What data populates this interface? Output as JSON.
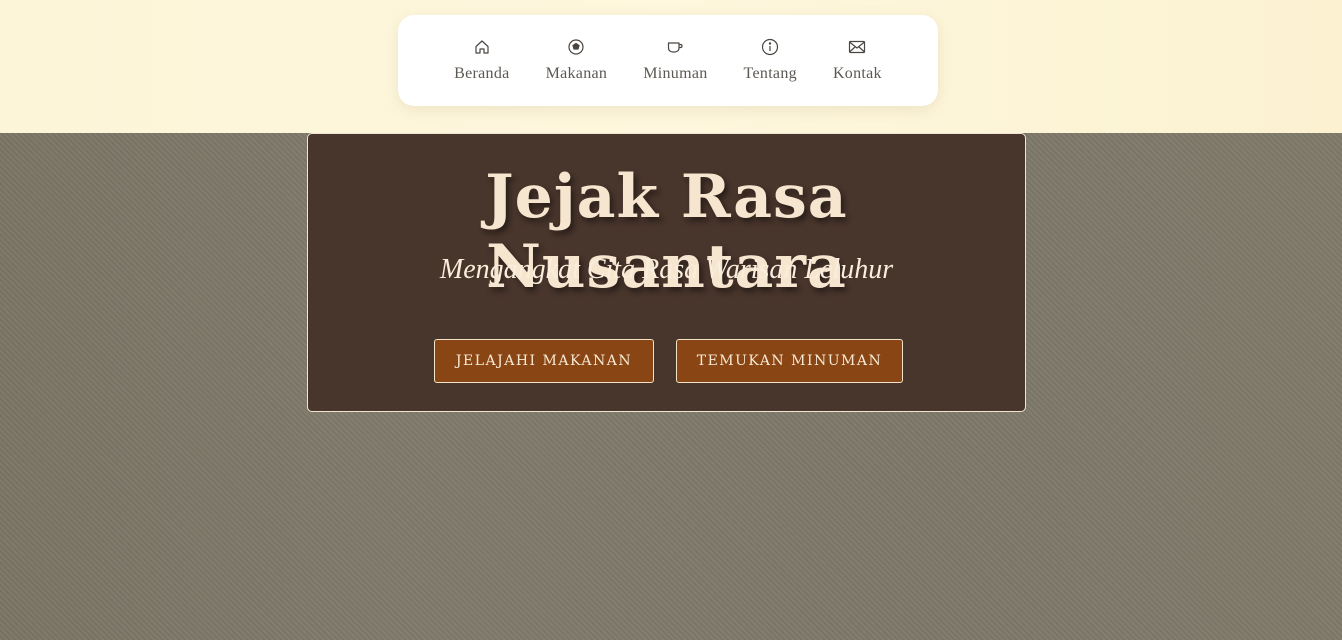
{
  "nav": {
    "items": [
      {
        "label": "Beranda",
        "icon": "home-icon"
      },
      {
        "label": "Makanan",
        "icon": "plate-icon"
      },
      {
        "label": "Minuman",
        "icon": "cup-icon"
      },
      {
        "label": "Tentang",
        "icon": "info-icon"
      },
      {
        "label": "Kontak",
        "icon": "mail-icon"
      }
    ]
  },
  "hero": {
    "title": "Jejak Rasa Nusantara",
    "subtitle": "Mengangkat Cita Rasa Warisan Leluhur",
    "buttons": {
      "food_label": "JELAJAHI MAKANAN",
      "drink_label": "TEMUKAN MINUMAN"
    }
  },
  "colors": {
    "card_bg": "#48352c",
    "button_bg": "#8a4514",
    "title_text": "#f6e6cf",
    "page_top": "#fdf6dc",
    "hero_backdrop": "#807a6c"
  }
}
